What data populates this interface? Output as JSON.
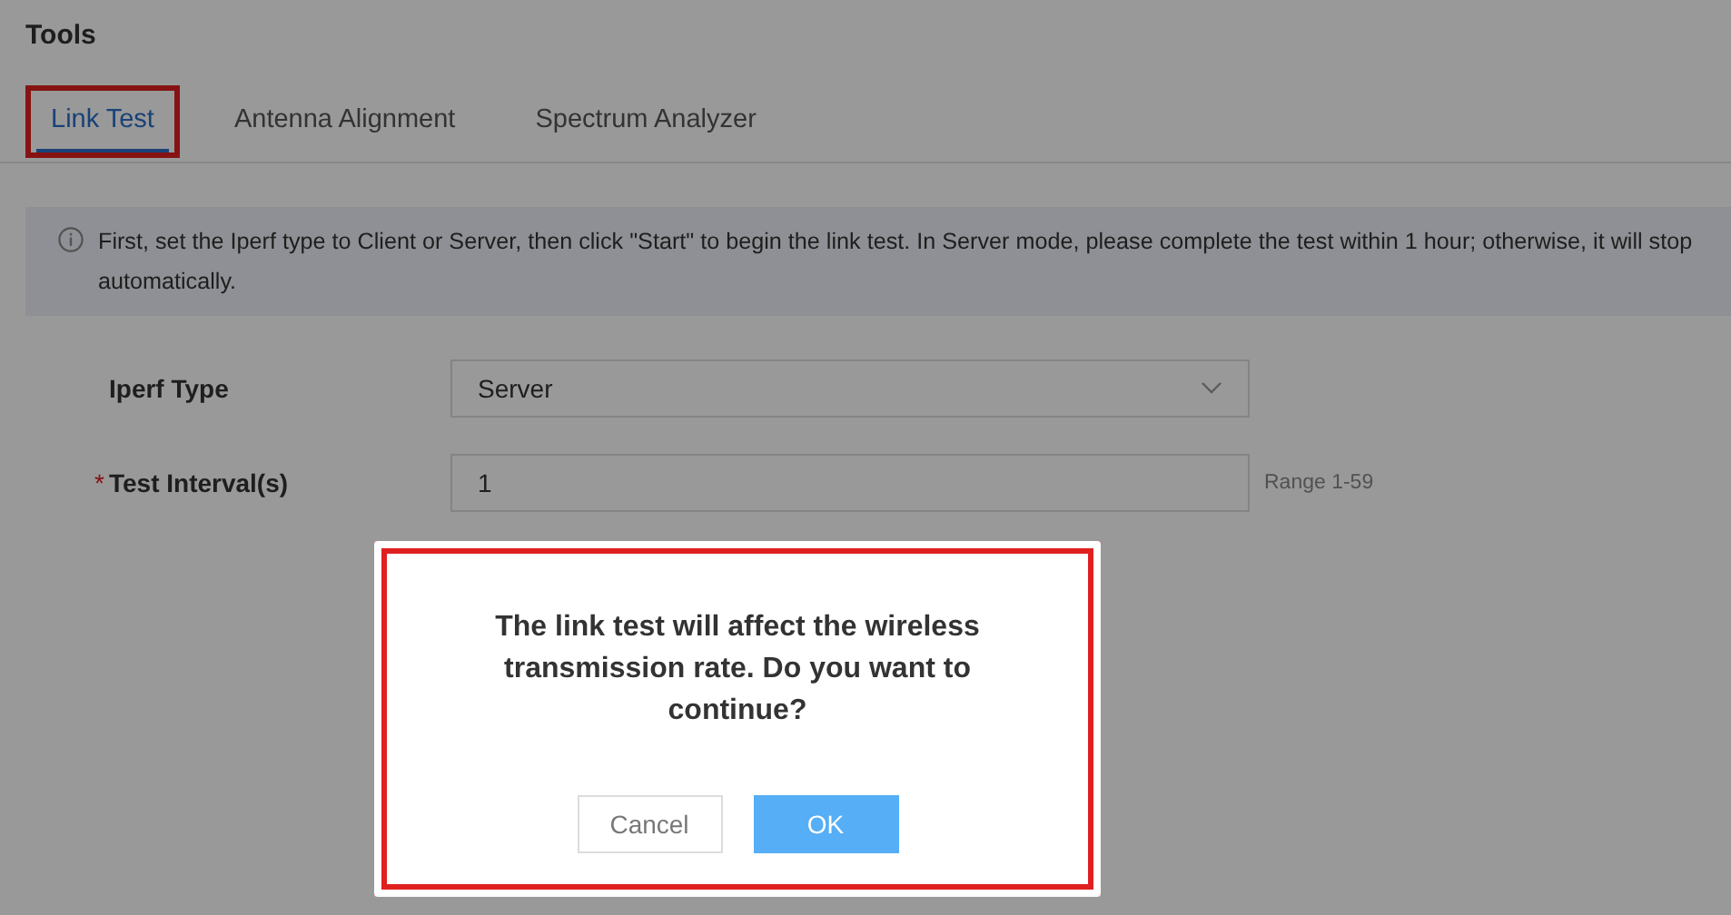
{
  "page": {
    "title": "Tools"
  },
  "tabs": [
    {
      "label": "Link Test",
      "selected": true,
      "highlighted": true
    },
    {
      "label": "Antenna Alignment",
      "selected": false,
      "highlighted": false
    },
    {
      "label": "Spectrum Analyzer",
      "selected": false,
      "highlighted": false
    }
  ],
  "notice": {
    "text": "First, set the Iperf type to Client or Server, then click \"Start\" to begin the link test. In Server mode, please complete the test within 1 hour; otherwise, it will stop automatically."
  },
  "form": [
    {
      "kind": "select",
      "label": "Iperf Type",
      "value": "Server"
    },
    {
      "kind": "input",
      "label": "Test Interval(s)",
      "required_mark": "*",
      "value": "1",
      "hint": "Range 1-59"
    }
  ],
  "dialog": {
    "message": "The link test will affect the wireless transmission rate. Do you want to continue?",
    "highlighted": true,
    "buttons": [
      {
        "label": "Cancel",
        "kind": "secondary"
      },
      {
        "label": "OK",
        "kind": "primary"
      }
    ]
  }
}
